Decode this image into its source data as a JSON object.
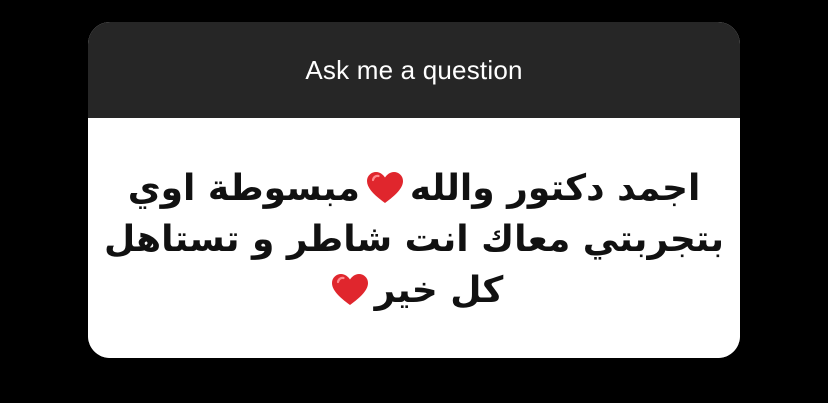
{
  "card": {
    "title": "Ask me a question",
    "answer": {
      "line1_before": "اجمد دكتور والله",
      "line1_after": "مبسوطة اوي",
      "line2": "بتجربتي معاك انت شاطر و تستاهل",
      "line3": "كل خير"
    }
  },
  "icons": {
    "heart": "red-heart-emoji"
  },
  "colors": {
    "background": "#000000",
    "header": "#262626",
    "body": "#ffffff",
    "heart": "#e0262d"
  }
}
